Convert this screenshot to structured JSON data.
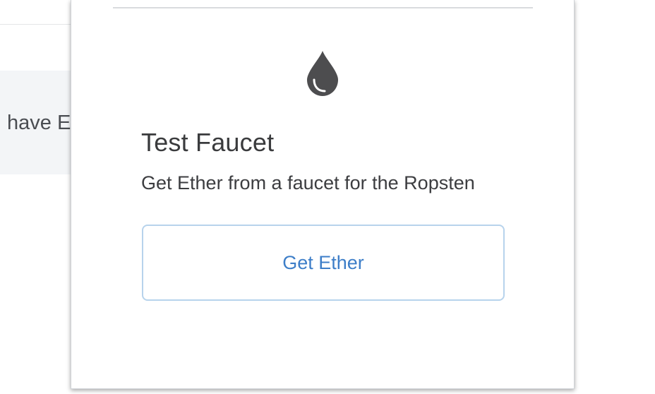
{
  "background": {
    "banner_text": "have E"
  },
  "faucet_card": {
    "icon": "drop-icon",
    "title": "Test Faucet",
    "description": "Get Ether from a faucet for the Ropsten",
    "button_label": "Get Ether"
  },
  "colors": {
    "icon": "#4d4d4f",
    "title": "#3a3b3d",
    "button_text": "#3d7ec8",
    "button_border": "#b7d3ec",
    "banner_bg": "#f3f5f7"
  }
}
